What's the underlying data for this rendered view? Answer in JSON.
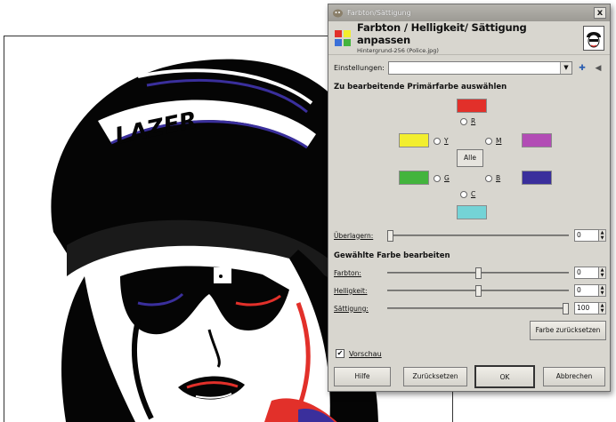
{
  "dialog": {
    "title": "Farbton/Sättigung",
    "close_label": "x",
    "header_title": "Farbton / Helligkeit/ Sättigung anpassen",
    "header_subtitle": "Hintergrund-256 (Police.jpg)"
  },
  "presets": {
    "label": "Einstellungen:",
    "value": ""
  },
  "primary_section": {
    "title": "Zu bearbeitende Primärfarbe auswählen",
    "master_label": "Alle",
    "colors": {
      "red": {
        "label": "R",
        "swatch": "#e2302a"
      },
      "yellow": {
        "label": "Y",
        "swatch": "#f2ee2e"
      },
      "magenta": {
        "label": "M",
        "swatch": "#b24cb5"
      },
      "green": {
        "label": "G",
        "swatch": "#43b43d"
      },
      "blue": {
        "label": "B",
        "swatch": "#3a2f9c"
      },
      "cyan": {
        "label": "C",
        "swatch": "#74d3d6"
      }
    }
  },
  "overlap": {
    "label": "Überlagern:",
    "value": "0",
    "level": 0.0
  },
  "edit_section": {
    "title": "Gewählte Farbe bearbeiten",
    "hue": {
      "label": "Farbton:",
      "value": "0",
      "level": 0.5
    },
    "lightness": {
      "label": "Helligkeit:",
      "value": "0",
      "level": 0.5
    },
    "saturation": {
      "label": "Sättigung:",
      "value": "100",
      "level": 1.0
    },
    "reset_color_label": "Farbe zurücksetzen"
  },
  "preview": {
    "label": "Vorschau",
    "checked": true
  },
  "buttons": {
    "help": "Hilfe",
    "reset": "Zurücksetzen",
    "ok": "OK",
    "cancel": "Abbrechen"
  }
}
